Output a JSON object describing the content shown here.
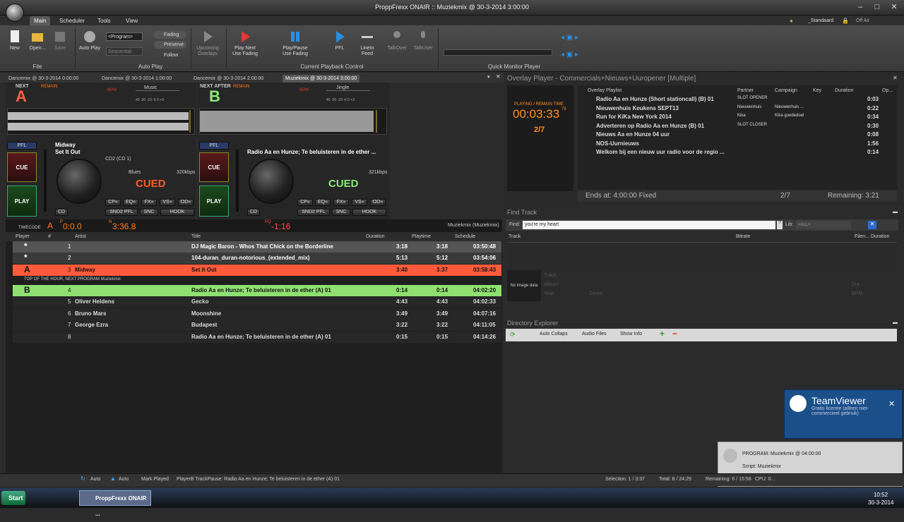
{
  "window": {
    "title": "ProppFrexx ONAIR :: Muziekmix @ 30-3-2014 3:00:00",
    "user": "_Standaard",
    "offair": "Off Air"
  },
  "ribbon_tabs": [
    {
      "label": "Main"
    },
    {
      "label": "Scheduler"
    },
    {
      "label": "Tools"
    },
    {
      "label": "View"
    }
  ],
  "ribbon": {
    "file": {
      "group": "File",
      "new": "New",
      "open": "Open...",
      "save": "Save"
    },
    "autoplay": {
      "group": "Auto Play",
      "autoplay": "Auto Play",
      "program": "<Program>",
      "sequential": "Sequential",
      "fading": "Fading",
      "preserve": "Preserve",
      "follow": "Follow"
    },
    "playback": {
      "group": "Current Playback Control",
      "upcoming": "Upcoming Overlays",
      "playnext": "Play Next Use Fading",
      "playpause": "Play/Pause Use Fading",
      "pfl": "PFL",
      "linein": "LineIn Feed",
      "talkover": "TalkOver",
      "talkuser": "TalkUser"
    },
    "monitor": {
      "group": "Quick Monitor Player"
    }
  },
  "doc_tabs": [
    {
      "label": "Dancemix @ 30-3-2014 0:00:00"
    },
    {
      "label": "Dancemix @ 30-3-2014 1:00:00"
    },
    {
      "label": "Dancemix @ 30-3-2014 2:00:00"
    },
    {
      "label": "Muziekmix @ 30-3-2014 3:00:00"
    }
  ],
  "deckA": {
    "header": "NEXT",
    "letter": "A",
    "remain": "REMAIN",
    "bpm": "BPM",
    "style": "Music",
    "scale": "40 -20 -10 -6 0 +3",
    "pfl": "PFL",
    "artist": "Midway",
    "title": "Set It Out",
    "cd": "CD2 (CD 1)",
    "genre": "Blues",
    "kbps": "320kbps",
    "status": "CUED",
    "cue": "CUE",
    "play": "PLAY",
    "btn_cd": "CD",
    "b_cp": "CP»",
    "b_eq": "EQ»",
    "b_fx": "FX»",
    "b_vs": "VS»",
    "b_od": "OD»",
    "snd2": "SND2 PFL",
    "snc": "SNC",
    "hook": "HOOK"
  },
  "deckB": {
    "header": "NEXT AFTER",
    "letter": "B",
    "remain": "REMAIN",
    "bpm": "BPM",
    "style": "Jingle",
    "scale": "40 -20 -10 -6 0 +3",
    "pfl": "PFL",
    "title": "Radio Aa en Hunze; Te beluisteren in de ether ...",
    "kbps": "321kbps",
    "status": "CUED",
    "cue": "CUE",
    "play": "PLAY",
    "btn_cd": "CD",
    "b_cp": "CP»",
    "b_eq": "EQ»",
    "b_fx": "FX»",
    "b_vs": "VS»",
    "b_od": "OD»",
    "snd2": "SND2 PFL",
    "snc": "SNC",
    "hook": "HOOK"
  },
  "timebar": {
    "timecode": "TIMECODE",
    "letter": "A",
    "p": "P",
    "pv": "0:0.0",
    "n": "N",
    "nv": "3:36.8",
    "pq": "PQ",
    "pqv": "-1:16",
    "label": "Muziekmix (Muziekmix)"
  },
  "playlist": {
    "columns": {
      "player": "Player",
      "num": "#",
      "artist": "Artist",
      "title": "Title",
      "duration": "Duration",
      "playtime": "Playtime",
      "schedule": "Schedule"
    },
    "rows": [
      {
        "player": "*",
        "num": "1",
        "artist": "",
        "title": "DJ Magic Baron - Whos That Chick on the Borderline",
        "duration": "3:18",
        "playtime": "3:18",
        "schedule": "03:50:48"
      },
      {
        "player": "*",
        "num": "2",
        "artist": "",
        "title": "104-duran_duran-notorious_(extended_mix)",
        "duration": "5:13",
        "playtime": "5:12",
        "schedule": "03:54:06"
      },
      {
        "player": "A",
        "num": "3",
        "artist": "Midway",
        "title": "Set It Out",
        "duration": "3:40",
        "playtime": "3:37",
        "schedule": "03:58:43"
      },
      {
        "player": "B",
        "num": "4",
        "artist": "",
        "title": "Radio Aa en Hunze; Te beluisteren in de ether (A) 01",
        "duration": "0:14",
        "playtime": "0:14",
        "schedule": "04:02:20"
      },
      {
        "player": "",
        "num": "5",
        "artist": "Oliver Heldens",
        "title": "Gecko",
        "duration": "4:43",
        "playtime": "4:43",
        "schedule": "04:02:33"
      },
      {
        "player": "",
        "num": "6",
        "artist": "Bruno Mars",
        "title": "Moonshine",
        "duration": "3:49",
        "playtime": "3:49",
        "schedule": "04:07:16"
      },
      {
        "player": "",
        "num": "7",
        "artist": "George Ezra",
        "title": "Budapest",
        "duration": "3:22",
        "playtime": "3:22",
        "schedule": "04:11:05"
      },
      {
        "player": "",
        "num": "8",
        "artist": "",
        "title": "Radio Aa en Hunze; Te beluisteren in de ether (A) 01",
        "duration": "0:15",
        "playtime": "0:15",
        "schedule": "04:14:26"
      }
    ],
    "separator": "TOP OF THE HOUR,  NEXT PROGRAM Muziekmix"
  },
  "overlay": {
    "title": "Overlay Player - Commercials+Nieuws+Uuropener [Multiple]",
    "clock_label": "PLAYING / REMAIN TIME",
    "clock": "00:03:33",
    "clock_frac": "79",
    "count": "2/7",
    "columns": {
      "playlist": "Overlay Playlist",
      "partner": "Partner",
      "campaign": "Campaign",
      "key": "Key",
      "duration": "Duration",
      "op": "Op..."
    },
    "rows": [
      {
        "title": "Radio Aa en Hunze (Short stationcall) (B) 01",
        "partner": "SLOT OPENER",
        "campaign": "",
        "duration": "0:03"
      },
      {
        "title": "Nieuwenhuis Keukens SEPT13",
        "partner": "Nieuwenhuis",
        "campaign": "Nieuwenhuis ...",
        "duration": "0:22"
      },
      {
        "title": "Run for KiKa New York 2014",
        "partner": "Kika",
        "campaign": "Kika goededoel",
        "duration": "0:34"
      },
      {
        "title": "Adverteren op Radio Aa en Hunze (B) 01",
        "partner": "SLOT CLOSER",
        "campaign": "",
        "duration": "0:30"
      },
      {
        "title": "Nieuws Aa en Hunze 04 uur",
        "partner": "",
        "campaign": "",
        "duration": "0:08"
      },
      {
        "title": "NOS-Uurnieuws",
        "partner": "",
        "campaign": "",
        "duration": "1:56"
      },
      {
        "title": "Welkom bij een nieuw uur radio voor de regio ...",
        "partner": "",
        "campaign": "",
        "duration": "0:14"
      }
    ],
    "footer": {
      "ends": "Ends at: 4:00:00  Fixed",
      "count": "2/7",
      "remaining": "Remaining: 3:21"
    }
  },
  "find": {
    "title": "Find Track",
    "find_label": "Find:",
    "query": "you're my heart",
    "lib_label": "Lib:",
    "lib_value": "<ALL>",
    "col_track": "Track",
    "col_bitrate": "Bitrate",
    "col_file": "Filen... Duration",
    "noimage": "No image data",
    "f_track": "Track:",
    "f_album": "Album:",
    "f_year": "Year:",
    "f_genre": "Genre:",
    "f_dur": "Dur.:",
    "f_bpm": "BPM:"
  },
  "directory": {
    "title": "Directory Explorer",
    "auto_collaps": "Auto Collaps",
    "audio_files": "Audio Files",
    "show_info": "Show Info"
  },
  "teamviewer": {
    "title": "TeamViewer",
    "sub": "Gratis licentie (alleen niet-commercieel gebruik)"
  },
  "program_popup": {
    "program": "PROGRAM: Muziekmix @ 04:00:00",
    "script": "Script: Muziekmix"
  },
  "status": {
    "auto1": "Auto",
    "auto2": "Auto",
    "mark": "Mark Played",
    "trackpause": "PlayerB TrackPause: Radio Aa en Hunze; Te beluisteren in de ether (A) 01",
    "selection": "Selection: 1 / 3:37",
    "total": "Total: 8 / 24:29",
    "remaining": "Remaining: 6 / 15:58",
    "cpu": "CPU: 0..."
  },
  "taskbar": {
    "start": "Start",
    "app": "ProppFrexx ONAIR ...",
    "time": "10:52",
    "date": "30-3-2014"
  }
}
